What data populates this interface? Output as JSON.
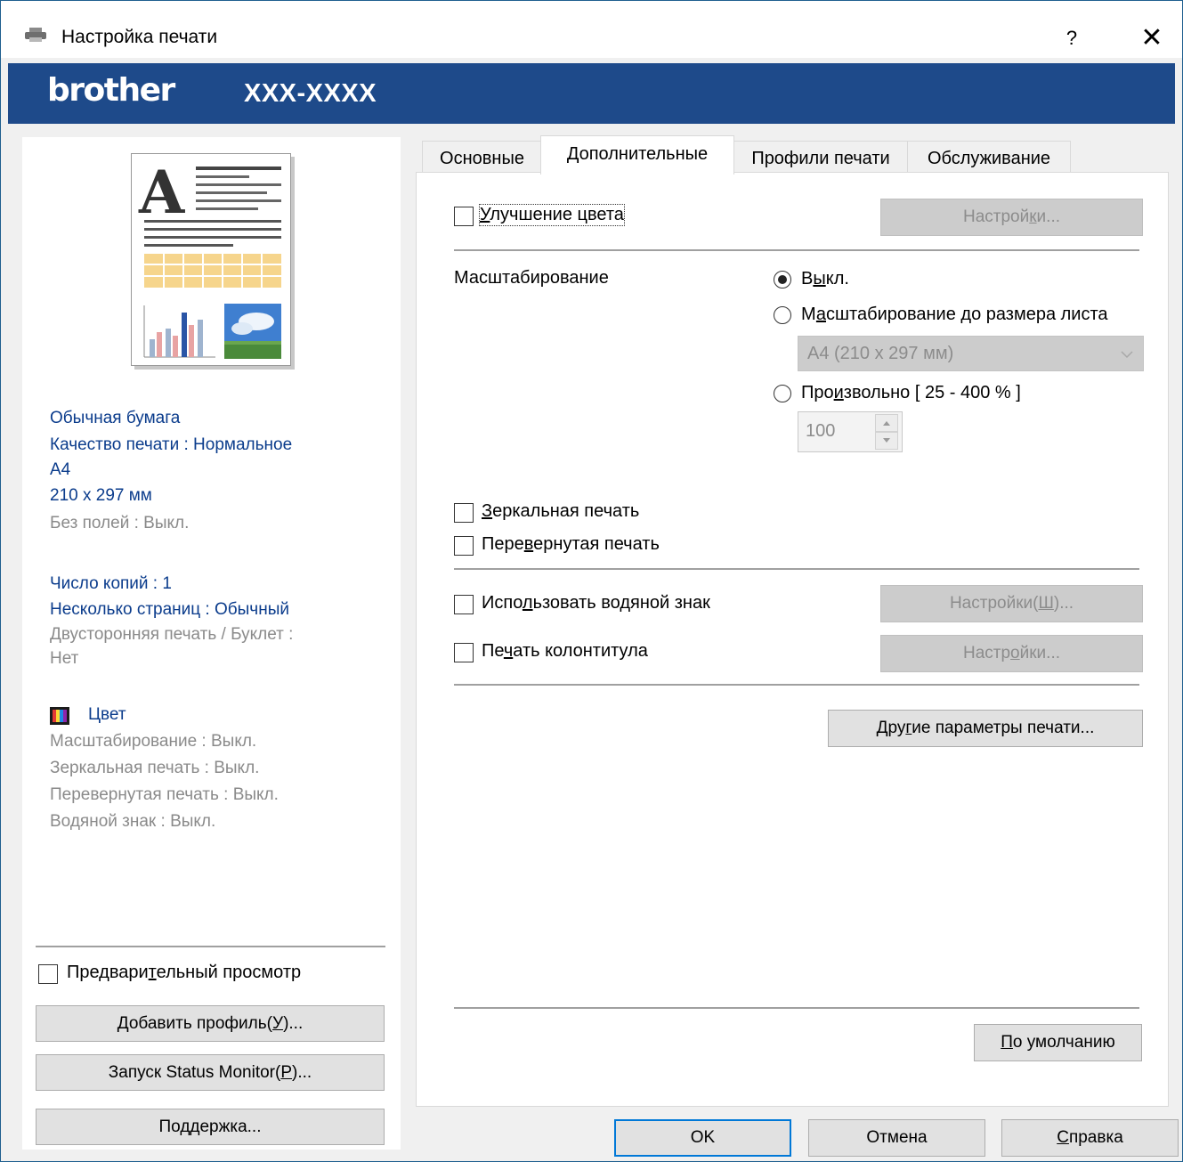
{
  "window": {
    "title": "Настройка печати",
    "help_glyph": "?",
    "close_glyph": "✕"
  },
  "banner": {
    "brand": "brother",
    "model": "XXX-XXXX"
  },
  "left_panel": {
    "summary_blue_1": [
      "Обычная бумага",
      "Качество печати : Нормальное",
      "A4",
      "210 x 297 мм"
    ],
    "summary_gray_1": [
      "Без полей : Выкл."
    ],
    "summary_blue_2": [
      "Число копий : 1",
      "Несколько страниц : Обычный"
    ],
    "summary_gray_2": [
      "Двусторонняя печать / Буклет :",
      "Нет"
    ],
    "color_label": "Цвет",
    "summary_gray_3": [
      "Масштабирование : Выкл.",
      "Зеркальная печать : Выкл.",
      "Перевернутая печать : Выкл.",
      "Водяной знак : Выкл."
    ],
    "preview_checkbox": {
      "pre": "Предвари",
      "u": "т",
      "post": "ельный просмотр"
    },
    "add_profile_button": {
      "pre": "Добавить профиль(",
      "u": "У",
      "post": ")..."
    },
    "status_monitor_button": {
      "pre": "Запуск Status Monitor(",
      "u": "Р",
      "post": ")..."
    },
    "support_button": "Поддержка..."
  },
  "tabs": [
    "Основные",
    "Дополнительные",
    "Профили печати",
    "Обслуживание"
  ],
  "advanced": {
    "color_enhance": {
      "pre": "",
      "u": "У",
      "post": "лучшение цвета",
      "checked": false
    },
    "color_settings_button": {
      "pre": "Настрой",
      "u": "к",
      "post": "и..."
    },
    "scaling_label": "Масштабирование",
    "scaling_off": {
      "pre": "В",
      "u": "ы",
      "post": "кл.",
      "selected": true
    },
    "scaling_fit": {
      "pre": "М",
      "u": "а",
      "post": "сштабирование до размера листа",
      "selected": false
    },
    "paper_select_value": "A4 (210 x 297 мм)",
    "scaling_free": {
      "pre": "Про",
      "u": "и",
      "post": "звольно [ 25 - 400 % ]",
      "selected": false
    },
    "scaling_free_value": "100",
    "mirror_print": {
      "pre": "",
      "u": "З",
      "post": "еркальная печать",
      "checked": false
    },
    "reverse_print": {
      "pre": "Пере",
      "u": "в",
      "post": "ернутая печать",
      "checked": false
    },
    "watermark": {
      "pre": "Испо",
      "u": "л",
      "post": "ьзовать водяной знак",
      "checked": false
    },
    "watermark_settings_button": {
      "pre": "Настройки(",
      "u": "Ш",
      "post": ")..."
    },
    "header_footer": {
      "pre": "Пе",
      "u": "ч",
      "post": "ать колонтитула",
      "checked": false
    },
    "header_settings_button": {
      "pre": "Настр",
      "u": "о",
      "post": "йки..."
    },
    "other_params_button": {
      "pre": "Дру",
      "u": "г",
      "post": "ие параметры печати..."
    },
    "default_button": {
      "pre": "",
      "u": "П",
      "post": "о умолчанию"
    }
  },
  "footer": {
    "ok_button": "OK",
    "cancel_button": "Отмена",
    "help_button": {
      "pre": "",
      "u": "С",
      "post": "правка"
    }
  },
  "colors": {
    "banner": "#1e4a8a",
    "summary_blue": "#0b3c8c",
    "summary_gray": "#8a8a8a",
    "accent_focus": "#0078d7"
  }
}
